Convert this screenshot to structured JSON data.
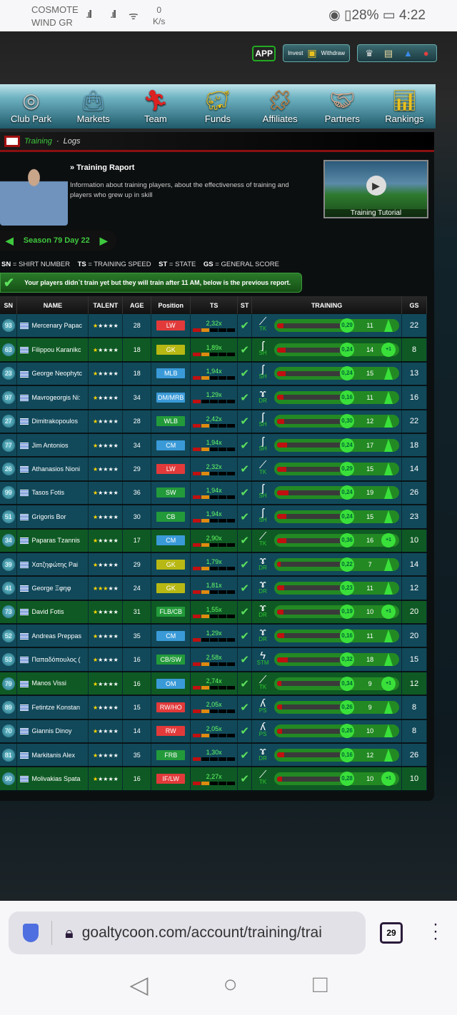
{
  "status_bar": {
    "carrier1": "COSMOTE",
    "carrier2": "WIND GR",
    "net_speed_value": "0",
    "net_speed_unit": "K/s",
    "battery": "28%",
    "time": "4:22"
  },
  "top_buttons": {
    "app": "APP",
    "invest": "Invest",
    "withdraw": "Withdraw"
  },
  "nav": [
    {
      "label": "Club Park",
      "icon": "stadium-icon"
    },
    {
      "label": "Markets",
      "icon": "shopping-bag-icon"
    },
    {
      "label": "Team",
      "icon": "player-icon"
    },
    {
      "label": "Funds",
      "icon": "piggy-bank-icon"
    },
    {
      "label": "Affiliates",
      "icon": "puzzle-icon"
    },
    {
      "label": "Partners",
      "icon": "handshake-icon"
    },
    {
      "label": "Rankings",
      "icon": "bar-chart-icon"
    }
  ],
  "breadcrumb": {
    "section": "Training",
    "sep": " · ",
    "page": "Logs"
  },
  "report": {
    "title": "» Training Raport",
    "description": "Information about training players, about the effectiveness of training and players who grew up in skill",
    "tutorial": "Training Tutorial"
  },
  "season": "Season 79 Day 22",
  "legend": {
    "sn": "SN",
    "sn_text": " = SHIRT NUMBER",
    "ts": "TS",
    "ts_text": " = TRAINING SPEED",
    "st": "ST",
    "st_text": " = STATE",
    "gs": "GS",
    "gs_text": " = GENERAL SCORE"
  },
  "notice": "Your players didn`t train yet but they will train after 11 AM, below is the previous report.",
  "columns": [
    "SN",
    "NAME",
    "TALENT",
    "AGE",
    "Position",
    "TS",
    "ST",
    "TRAINING",
    "GS"
  ],
  "colors": {
    "LW": "#e23a3a",
    "GK": "#b8b814",
    "MLB": "#3a9ad8",
    "DM/MRB": "#3a9ad8",
    "WLB": "#239a3a",
    "CM": "#3a9ad8",
    "SW": "#239a3a",
    "CB": "#239a3a",
    "FLB/CB": "#239a3a",
    "CB/SW": "#239a3a",
    "OM": "#3a9ad8",
    "RW/HO": "#e23a3a",
    "RW": "#e23a3a",
    "FRB": "#239a3a",
    "IF/LW": "#e23a3a"
  },
  "rows": [
    {
      "sn": "93",
      "name": "Mercenary Papac",
      "talent": 1,
      "age": "28",
      "pos": "LW",
      "ts": "2,32x",
      "ts_level": 2,
      "skill": "TK",
      "progress": 0.1,
      "eff": "0,29",
      "count": "11",
      "up": false,
      "gs": "22"
    },
    {
      "sn": "63",
      "name": "Filippou Karanikc",
      "talent": 1,
      "age": "18",
      "pos": "GK",
      "ts": "1,89x",
      "ts_level": 2,
      "skill": "SH",
      "progress": 0.13,
      "eff": "0,24",
      "count": "14",
      "up": true,
      "gs": "8"
    },
    {
      "sn": "23",
      "name": "George Neophytc",
      "talent": 1,
      "age": "18",
      "pos": "MLB",
      "ts": "1,94x",
      "ts_level": 2,
      "skill": "SH",
      "progress": 0.13,
      "eff": "0,24",
      "count": "15",
      "up": false,
      "gs": "13"
    },
    {
      "sn": "97",
      "name": "Mavrogeorgis Ni:",
      "talent": 1,
      "age": "34",
      "pos": "DM/MRB",
      "ts": "1,29x",
      "ts_level": 1,
      "skill": "DR",
      "progress": 0.1,
      "eff": "0,16",
      "count": "11",
      "up": false,
      "gs": "16"
    },
    {
      "sn": "27",
      "name": "Dimitrakopoulos",
      "talent": 1,
      "age": "28",
      "pos": "WLB",
      "ts": "2,42x",
      "ts_level": 2,
      "skill": "SH",
      "progress": 0.11,
      "eff": "0,30",
      "count": "12",
      "up": false,
      "gs": "22"
    },
    {
      "sn": "77",
      "name": "Jim Antonios",
      "talent": 1,
      "age": "34",
      "pos": "CM",
      "ts": "1,94x",
      "ts_level": 2,
      "skill": "SH",
      "progress": 0.16,
      "eff": "0,24",
      "count": "17",
      "up": false,
      "gs": "18"
    },
    {
      "sn": "26",
      "name": "Athanasios Nioni",
      "talent": 1,
      "age": "29",
      "pos": "LW",
      "ts": "2,32x",
      "ts_level": 2,
      "skill": "TK",
      "progress": 0.14,
      "eff": "0,29",
      "count": "15",
      "up": false,
      "gs": "14"
    },
    {
      "sn": "99",
      "name": "Tasos Fotis",
      "talent": 1,
      "age": "36",
      "pos": "SW",
      "ts": "1,94x",
      "ts_level": 2,
      "skill": "SH",
      "progress": 0.18,
      "eff": "0,24",
      "count": "19",
      "up": false,
      "gs": "26"
    },
    {
      "sn": "51",
      "name": "Grigoris Bor",
      "talent": 1,
      "age": "30",
      "pos": "CB",
      "ts": "1,94x",
      "ts_level": 2,
      "skill": "SH",
      "progress": 0.14,
      "eff": "0,24",
      "count": "15",
      "up": false,
      "gs": "23"
    },
    {
      "sn": "34",
      "name": "Paparas Tzannis",
      "talent": 1,
      "age": "17",
      "pos": "CM",
      "ts": "2,90x",
      "ts_level": 2,
      "skill": "TK",
      "progress": 0.14,
      "eff": "0,36",
      "count": "16",
      "up": true,
      "gs": "10"
    },
    {
      "sn": "39",
      "name": "Χατζηφώτης Pai",
      "talent": 1,
      "age": "29",
      "pos": "GK",
      "ts": "1,79x",
      "ts_level": 2,
      "skill": "DR",
      "progress": 0.05,
      "eff": "0,22",
      "count": "7",
      "up": false,
      "gs": "14"
    },
    {
      "sn": "41",
      "name": "George Ξφηφ",
      "talent": 3,
      "age": "24",
      "pos": "GK",
      "ts": "1,81x",
      "ts_level": 2,
      "skill": "DR",
      "progress": 0.11,
      "eff": "0,23",
      "count": "11",
      "up": false,
      "gs": "12"
    },
    {
      "sn": "73",
      "name": "David Fotis",
      "talent": 1,
      "age": "31",
      "pos": "FLB/CB",
      "ts": "1,55x",
      "ts_level": 2,
      "skill": "DR",
      "progress": 0.1,
      "eff": "0,19",
      "count": "10",
      "up": true,
      "gs": "20"
    },
    {
      "sn": "52",
      "name": "Andreas Preppas",
      "talent": 1,
      "age": "35",
      "pos": "CM",
      "ts": "1,29x",
      "ts_level": 1,
      "skill": "DR",
      "progress": 0.11,
      "eff": "0,16",
      "count": "11",
      "up": false,
      "gs": "20"
    },
    {
      "sn": "53",
      "name": "Παπαδόπουλος (",
      "talent": 1,
      "age": "16",
      "pos": "CB/SW",
      "ts": "2,58x",
      "ts_level": 2,
      "skill": "STM",
      "progress": 0.17,
      "eff": "0,32",
      "count": "18",
      "up": false,
      "gs": "15"
    },
    {
      "sn": "79",
      "name": "Manos Vissi",
      "talent": 1,
      "age": "16",
      "pos": "OM",
      "ts": "2,74x",
      "ts_level": 2,
      "skill": "TK",
      "progress": 0.07,
      "eff": "0,34",
      "count": "9",
      "up": true,
      "gs": "12"
    },
    {
      "sn": "89",
      "name": "Fetintze Konstan",
      "talent": 1,
      "age": "15",
      "pos": "RW/HO",
      "ts": "2,05x",
      "ts_level": 2,
      "skill": "PS",
      "progress": 0.08,
      "eff": "0,26",
      "count": "9",
      "up": false,
      "gs": "8"
    },
    {
      "sn": "70",
      "name": "Giannis Dinoy",
      "talent": 1,
      "age": "14",
      "pos": "RW",
      "ts": "2,05x",
      "ts_level": 2,
      "skill": "PS",
      "progress": 0.08,
      "eff": "0,26",
      "count": "10",
      "up": false,
      "gs": "8"
    },
    {
      "sn": "81",
      "name": "Markitanis Alex",
      "talent": 1,
      "age": "35",
      "pos": "FRB",
      "ts": "1,30x",
      "ts_level": 1,
      "skill": "DR",
      "progress": 0.11,
      "eff": "0,16",
      "count": "12",
      "up": false,
      "gs": "26"
    },
    {
      "sn": "90",
      "name": "Molivakias Spata",
      "talent": 1,
      "age": "16",
      "pos": "IF/LW",
      "ts": "2,27x",
      "ts_level": 2,
      "skill": "TK",
      "progress": 0.08,
      "eff": "0,28",
      "count": "10",
      "up": true,
      "gs": "10"
    }
  ],
  "up_label": "+1",
  "browser": {
    "url": "goaltycoon.com/account/training/trai",
    "tab_count": "29"
  }
}
